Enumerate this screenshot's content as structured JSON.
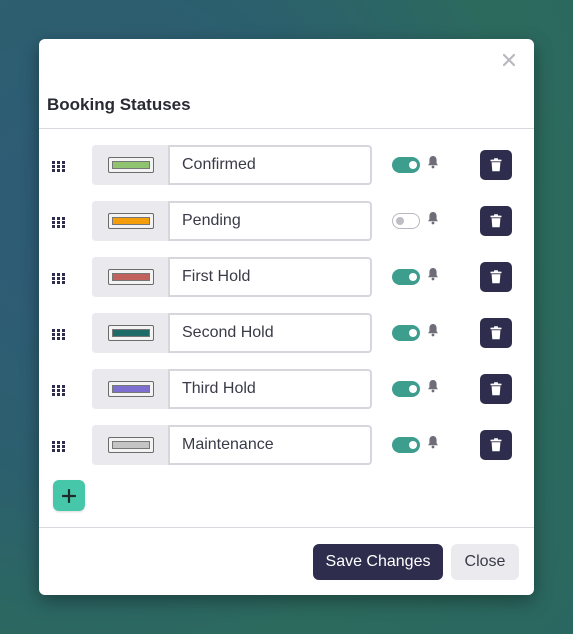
{
  "modal": {
    "title": "Booking Statuses",
    "save_label": "Save Changes",
    "close_label": "Close"
  },
  "statuses": [
    {
      "name": "Confirmed",
      "color": "#8fc36f",
      "notify": true
    },
    {
      "name": "Pending",
      "color": "#f59e0b",
      "notify": false
    },
    {
      "name": "First Hold",
      "color": "#c0625b",
      "notify": true
    },
    {
      "name": "Second Hold",
      "color": "#1f6b68",
      "notify": true
    },
    {
      "name": "Third Hold",
      "color": "#7c6fd0",
      "notify": true
    },
    {
      "name": "Maintenance",
      "color": "#c4c4c4",
      "notify": true
    }
  ],
  "colors": {
    "accent_dark": "#2e2d4e",
    "toggle_on": "#3e9e8e",
    "add_button": "#47c7a9"
  },
  "icons": {
    "close": "close-icon",
    "drag": "drag-handle-icon",
    "bell": "bell-icon",
    "trash": "trash-icon",
    "add": "plus-icon"
  }
}
